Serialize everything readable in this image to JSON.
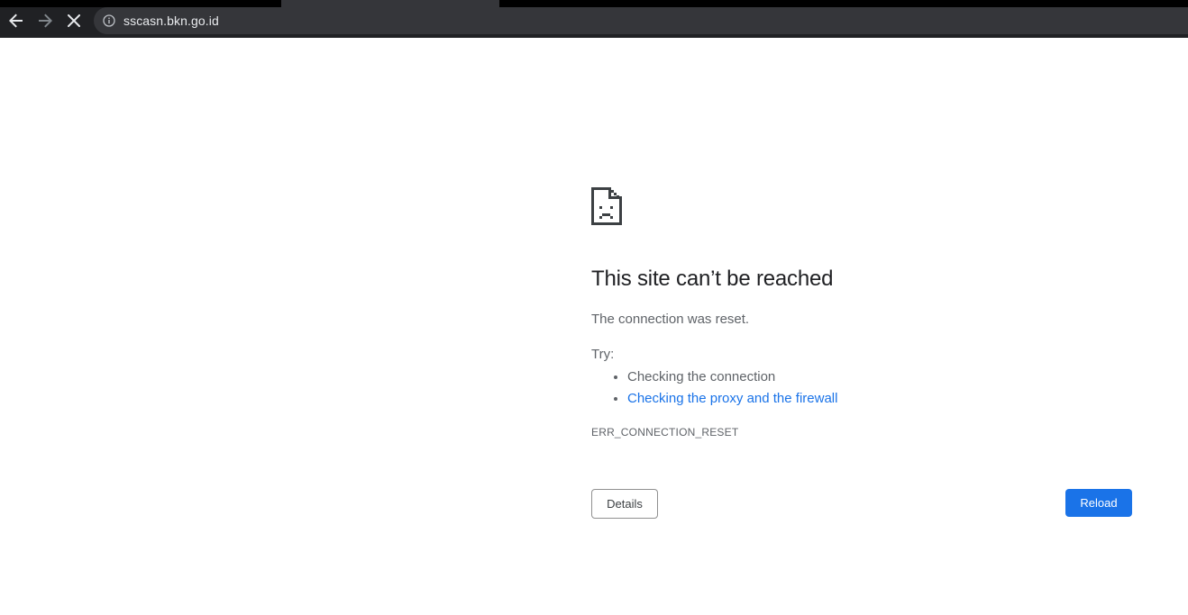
{
  "browser": {
    "url": "sscasn.bkn.go.id",
    "icons": {
      "back": "arrow-left-icon",
      "forward": "arrow-right-icon",
      "stop": "close-icon",
      "site_info": "info-icon"
    }
  },
  "error_page": {
    "icon": "sad-document-icon",
    "heading": "This site can’t be reached",
    "subtext": "The connection was reset.",
    "try_label": "Try:",
    "suggestions": [
      {
        "label": "Checking the connection",
        "is_link": false
      },
      {
        "label": "Checking the proxy and the firewall",
        "is_link": true
      }
    ],
    "error_code": "ERR_CONNECTION_RESET",
    "details_label": "Details",
    "reload_label": "Reload"
  },
  "colors": {
    "toolbar_bg": "#202124",
    "omnibox_bg": "#35363a",
    "link": "#1a73e8",
    "primary_button": "#1a73e8",
    "heading_text": "#202124",
    "body_text": "#5f6368"
  }
}
